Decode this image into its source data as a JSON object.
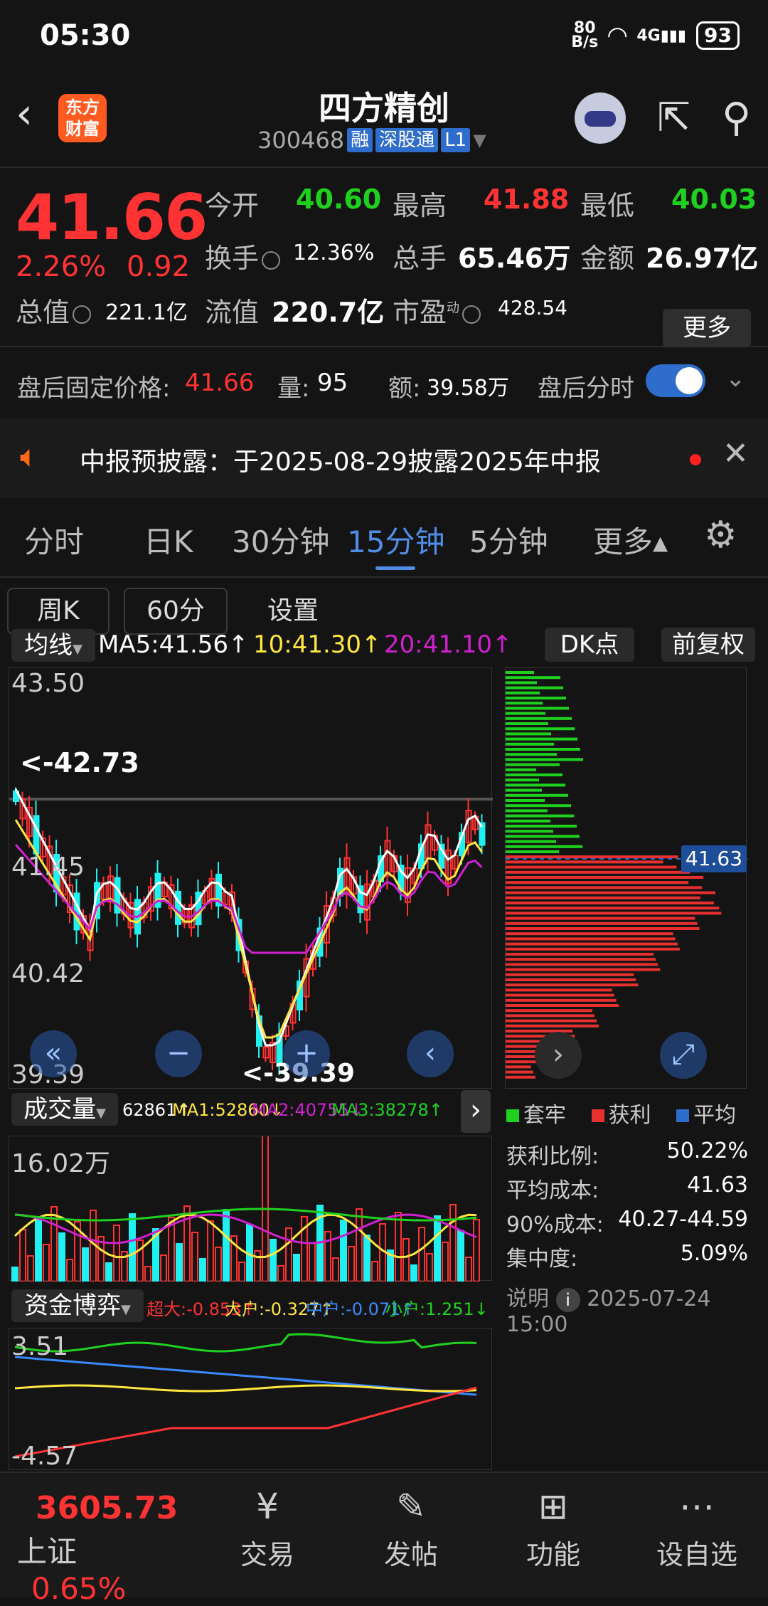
{
  "status": {
    "time": "05:30",
    "net_speed": "80\nB/s",
    "wifi_icon": "wifi-icon",
    "signal": "4G",
    "battery": "93"
  },
  "header": {
    "title": "四方精创",
    "code": "300468",
    "tags": [
      "融",
      "深股通",
      "L1"
    ],
    "logo_text": "东方\n财富"
  },
  "quote": {
    "price": "41.66",
    "pct": "2.26%",
    "change": "0.92",
    "open_label": "今开",
    "open": "40.60",
    "high_label": "最高",
    "high": "41.88",
    "low_label": "最低",
    "low": "40.03",
    "turnover_label": "换手",
    "turnover": "12.36%",
    "volume_label": "总手",
    "volume": "65.46万",
    "amount_label": "金额",
    "amount": "26.97亿",
    "mcap_label": "总值",
    "mcap": "221.1亿",
    "float_label": "流值",
    "float": "220.7亿",
    "pe_label": "市盈",
    "pe_sup": "动",
    "pe": "428.54",
    "more": "更多"
  },
  "after_hours": {
    "label": "盘后固定价格:",
    "price": "41.66",
    "vol_label": "量:",
    "vol": "95",
    "amt_label": "额:",
    "amt": "39.58万",
    "toggle_label": "盘后分时"
  },
  "notice": {
    "text": "中报预披露：于2025-08-29披露2025年中报"
  },
  "periods": [
    "分时",
    "日K",
    "30分钟",
    "15分钟",
    "5分钟",
    "更多▴"
  ],
  "period_active": 3,
  "subtabs": [
    "周K",
    "60分",
    "设置"
  ],
  "ma_bar": {
    "indicator": "均线",
    "ma5": "MA5:41.56↑",
    "ma10": "10:41.30↑",
    "ma20": "20:41.10↑",
    "dk": "DK点",
    "fq": "前复权"
  },
  "kline": {
    "y_labels": [
      "43.50",
      "41.45",
      "40.42",
      "39.39"
    ],
    "hi_note": "<-42.73",
    "lo_note": "<-39.39"
  },
  "chip": {
    "price": "41.63",
    "legend": [
      "套牢",
      "获利",
      "平均"
    ],
    "stats": [
      [
        "获利比例:",
        "50.22%"
      ],
      [
        "平均成本:",
        "41.63"
      ],
      [
        "90%成本:",
        "40.27-44.59"
      ],
      [
        "集中度:",
        "5.09%"
      ]
    ],
    "note_label": "说明",
    "date": "2025-07-24 15:00"
  },
  "volume": {
    "indicator": "成交量",
    "vol": "62861↑",
    "ma1": "MA1:52860↓",
    "ma2": "MA2:40755↓",
    "ma3": "MA3:38278↑",
    "ylab": "16.02万"
  },
  "fund": {
    "indicator": "资金博弈",
    "super": "超大:-0.853↑",
    "big": "大户:-0.327↑",
    "mid": "中户:-0.071↑",
    "small": "小户:1.251↓",
    "ytop": "3.51",
    "ybot": "-4.57"
  },
  "bottom": {
    "index_value": "3605.73",
    "index_name": "上证",
    "index_pct": "0.65%",
    "tabs": [
      "交易",
      "发帖",
      "功能",
      "设自选"
    ]
  },
  "colors": {
    "up": "#ff3333",
    "down": "#1fd11f",
    "accent": "#2f6dcc",
    "cyan": "#20f0f0"
  }
}
